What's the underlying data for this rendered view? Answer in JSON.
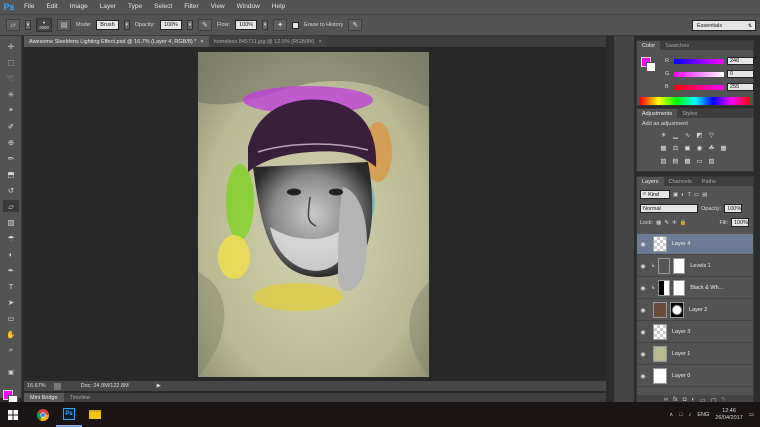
{
  "app": {
    "logo": "Ps"
  },
  "menu": [
    "File",
    "Edit",
    "Image",
    "Layer",
    "Type",
    "Select",
    "Filter",
    "View",
    "Window",
    "Help"
  ],
  "options": {
    "brush_size": "2500",
    "mode_label": "Mode:",
    "mode_value": "Brush",
    "opacity_label": "Opacity:",
    "opacity_value": "100%",
    "flow_label": "Flow:",
    "flow_value": "100%",
    "erase_history_label": "Erase to History",
    "workspace": "Essentials"
  },
  "doc_tabs": [
    {
      "label": "Awesome Sleekfens Lighting Effect.psd @ 16.7% (Layer 4, RGB/8) *",
      "close": "×"
    },
    {
      "label": "homeless 845711.jpg @ 12.5% (RGB/8#)",
      "close": "×"
    }
  ],
  "status": {
    "zoom": "16.67%",
    "doc_size": "Doc: 24.9M/122.8M"
  },
  "bottom_tabs": [
    "Mini Bridge",
    "Timeline"
  ],
  "color_panel": {
    "tabs": [
      "Color",
      "Swatches"
    ],
    "channels": [
      {
        "name": "R",
        "value": "246"
      },
      {
        "name": "G",
        "value": "0"
      },
      {
        "name": "B",
        "value": "255"
      }
    ],
    "fg_color": "#ff00ff"
  },
  "adjustments_panel": {
    "tabs": [
      "Adjustments",
      "Styles"
    ],
    "title": "Add an adjustment"
  },
  "layers_panel": {
    "tabs": [
      "Layers",
      "Channels",
      "Paths"
    ],
    "kind": "Kind",
    "blend_mode": "Normal",
    "opacity_label": "Opacity:",
    "opacity_value": "100%",
    "lock_label": "Lock:",
    "fill_label": "Fill:",
    "fill_value": "100%",
    "layers": [
      {
        "name": "Layer 4",
        "selected": true
      },
      {
        "name": "Levels 1",
        "selected": false
      },
      {
        "name": "Black & Wh...",
        "selected": false
      },
      {
        "name": "Layer 2",
        "selected": false
      },
      {
        "name": "Layer 3",
        "selected": false
      },
      {
        "name": "Layer 1",
        "selected": false
      },
      {
        "name": "Layer 0",
        "selected": false
      }
    ]
  },
  "taskbar": {
    "language": "ENG",
    "time": "12:46",
    "date": "26/04/2017"
  }
}
